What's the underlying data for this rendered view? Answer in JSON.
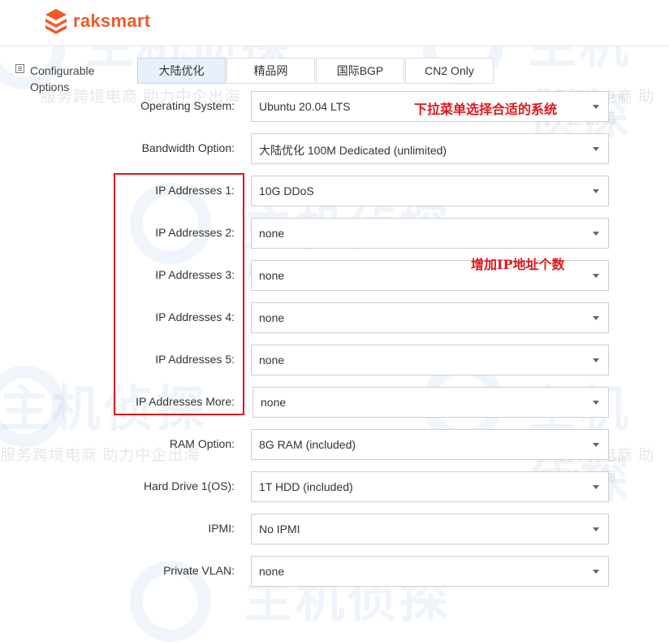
{
  "brand": {
    "name": "raksmart",
    "color": "#f05a28"
  },
  "sidebar": {
    "label_line1": "Configurable",
    "label_line2": "Options",
    "icon": "list-icon"
  },
  "tabs": [
    {
      "label": "大陆优化",
      "active": true
    },
    {
      "label": "精品网",
      "active": false
    },
    {
      "label": "国际BGP",
      "active": false
    },
    {
      "label": "CN2 Only",
      "active": false
    }
  ],
  "options": [
    {
      "label": "Operating System:",
      "value": "Ubuntu 20.04 LTS"
    },
    {
      "label": "Bandwidth Option:",
      "value": "大陆优化 100M Dedicated (unlimited)"
    },
    {
      "label": "IP Addresses 1:",
      "value": "10G DDoS"
    },
    {
      "label": "IP Addresses 2:",
      "value": "none"
    },
    {
      "label": "IP Addresses 3:",
      "value": "none"
    },
    {
      "label": "IP Addresses 4:",
      "value": "none"
    },
    {
      "label": "IP Addresses 5:",
      "value": "none"
    },
    {
      "label": "IP Addresses More:",
      "value": "none"
    },
    {
      "label": "RAM Option:",
      "value": "8G RAM (included)"
    },
    {
      "label": "Hard Drive 1(OS):",
      "value": "1T HDD (included)"
    },
    {
      "label": "IPMI:",
      "value": "No IPMI"
    },
    {
      "label": "Private VLAN:",
      "value": "none"
    }
  ],
  "annotations": {
    "os_note": "下拉菜单选择合适的系统",
    "ip_note": "增加IP地址个数",
    "color": "#e0161a"
  },
  "watermark": {
    "big": "主机侦探",
    "small": "服务跨境电商 助力中企出海"
  }
}
